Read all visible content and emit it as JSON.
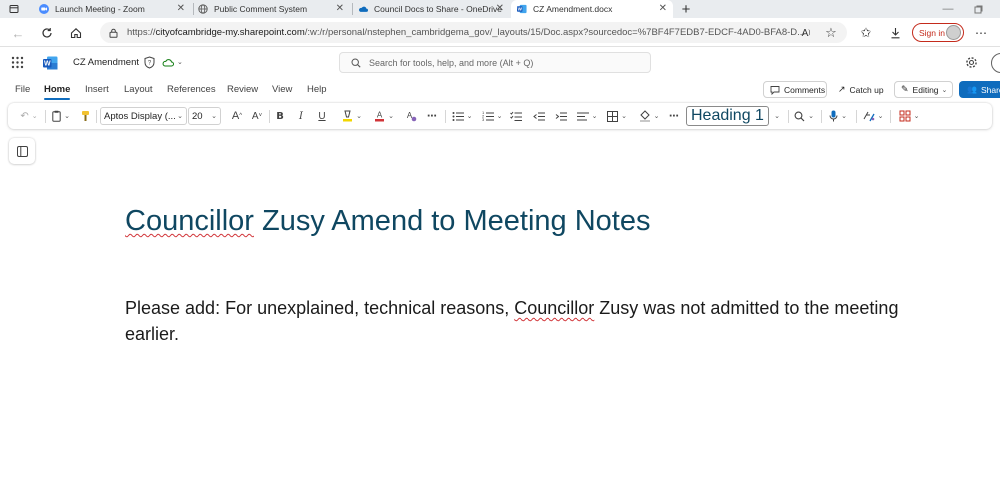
{
  "browser": {
    "tabs": [
      {
        "title": "Launch Meeting - Zoom",
        "icon": "zoom-icon"
      },
      {
        "title": "Public Comment System",
        "icon": "globe-icon"
      },
      {
        "title": "Council Docs to Share - OneDrive",
        "icon": "onedrive-icon"
      },
      {
        "title": "CZ Amendment.docx",
        "icon": "word-icon",
        "active": true
      }
    ],
    "url_prefix": "https://",
    "url_host": "cityofcambridge-my.sharepoint.com",
    "url_rest": "/:w:/r/personal/nstephen_cambridgema_gov/_layouts/15/Doc.aspx?sourcedoc=%7BF4F7EDB7-EDCF-4AD0-BFA8-D...",
    "sign_in": "Sign in"
  },
  "word": {
    "doc_title": "CZ Amendment",
    "search_placeholder": "Search for tools, help, and more (Alt + Q)",
    "ribbon_tabs": [
      "File",
      "Home",
      "Insert",
      "Layout",
      "References",
      "Review",
      "View",
      "Help"
    ],
    "comments_label": "Comments",
    "catchup_label": "Catch up",
    "editing_label": "Editing",
    "share_label": "Share",
    "font_name": "Aptos Display (...",
    "font_size": "20",
    "style_name": "Heading 1"
  },
  "document": {
    "heading_part1": "Councillor",
    "heading_part2": " Zusy Amend to Meeting Notes",
    "para_part1": "Please add: For unexplained, technical reasons, ",
    "para_part2": "Councillor",
    "para_part3": " Zusy was not admitted to the meeting earlier."
  },
  "colors": {
    "accent": "#0f6cbd",
    "heading": "#0f4761",
    "spell_error": "#d13438",
    "word_brand": "#185abd"
  }
}
